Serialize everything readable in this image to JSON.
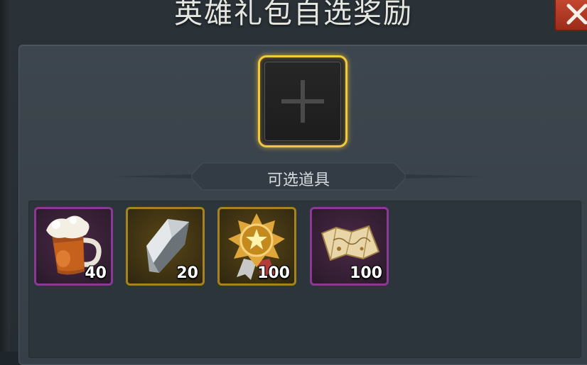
{
  "dialog": {
    "title": "英雄礼包自选奖励"
  },
  "selection": {
    "slot_icon": "plus-icon"
  },
  "section": {
    "label": "可选道具"
  },
  "items": [
    {
      "icon": "beer-mug-icon",
      "count": "40",
      "rarity": "purple"
    },
    {
      "icon": "silver-crystal-icon",
      "count": "20",
      "rarity": "gold"
    },
    {
      "icon": "star-medal-icon",
      "count": "100",
      "rarity": "gold"
    },
    {
      "icon": "treasure-map-icon",
      "count": "100",
      "rarity": "purple"
    }
  ],
  "colors": {
    "slot_highlight": "#f2c93a",
    "rarity_purple": "#8a3a95",
    "rarity_gold": "#a78320",
    "close_button": "#c84a32"
  }
}
